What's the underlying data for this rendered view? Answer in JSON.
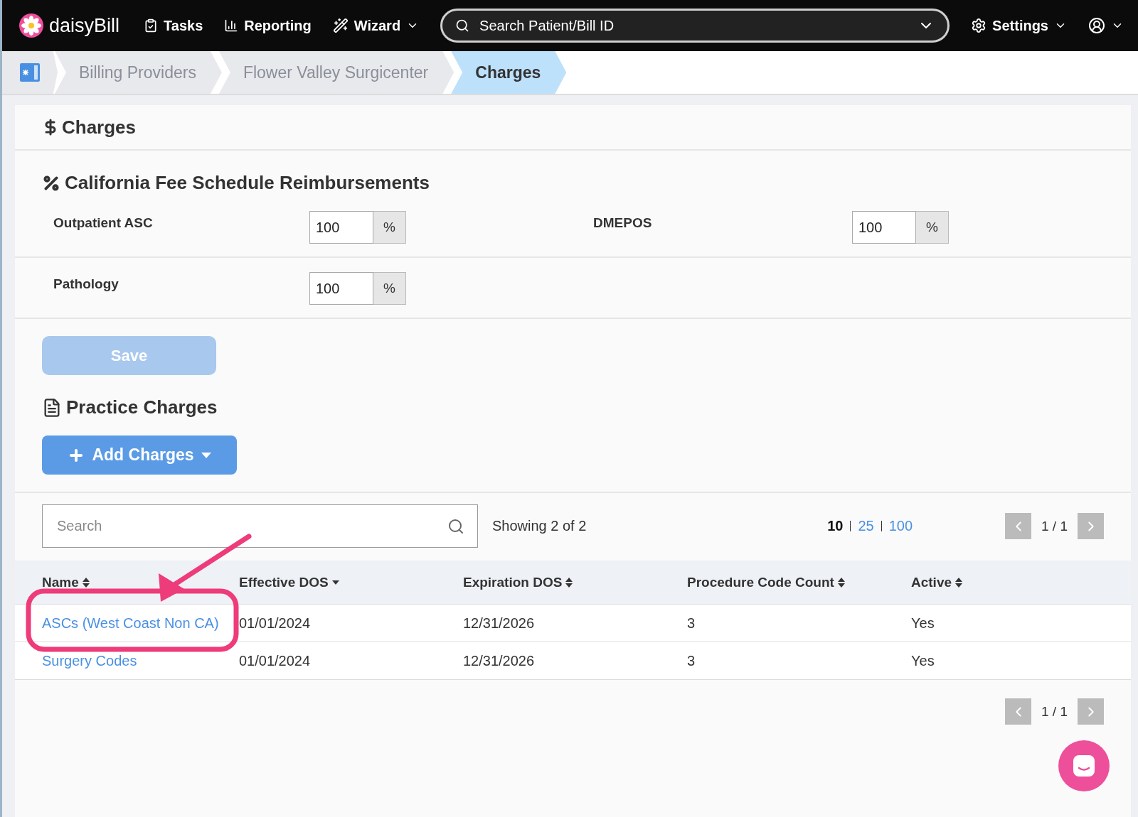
{
  "navbar": {
    "logo": "daisy**Bill**",
    "items": [
      {
        "kind": "tasks",
        "label": "Tasks",
        "dropdown": false
      },
      {
        "kind": "reporting",
        "label": "Reporting",
        "dropdown": false
      },
      {
        "kind": "wizard",
        "label": "Wizard",
        "dropdown": true
      }
    ],
    "search": {
      "placeholder": "Search Patient/Bill ID"
    },
    "settings": {
      "label": "Settings"
    }
  },
  "breadcrumb": [
    {
      "label": "Billing Providers",
      "selected": false
    },
    {
      "label": "Flower Valley Surgicenter",
      "selected": false
    },
    {
      "label": "Charges",
      "selected": true
    }
  ],
  "page_title": "Charges",
  "fee_schedule": {
    "title": "California Fee Schedule Reimbursements",
    "rows": [
      [
        {
          "label": "Outpatient ASC",
          "value": "100",
          "unit": "%"
        },
        {
          "label": "DMEPOS",
          "value": "100",
          "unit": "%"
        }
      ],
      [
        {
          "label": "Pathology",
          "value": "100",
          "unit": "%"
        }
      ]
    ],
    "save": {
      "label": "Save",
      "disabled": true
    }
  },
  "practice_charges": {
    "title": "Practice Charges",
    "add_button": "Add Charges",
    "search": {
      "placeholder": "Search"
    },
    "showing": "Showing 2 of 2",
    "page_sizes": [
      {
        "label": "10",
        "selected": true
      },
      {
        "label": "25",
        "selected": false
      },
      {
        "label": "100",
        "selected": false
      }
    ],
    "page": "1 / 1",
    "page_bottom": "1 / 1",
    "columns": [
      {
        "label": "Name",
        "sorted": false
      },
      {
        "label": "Effective DOS",
        "sorted": true
      },
      {
        "label": "Expiration DOS",
        "sorted": false
      },
      {
        "label": "Procedure Code Count",
        "sorted": false
      },
      {
        "label": "Active",
        "sorted": false
      }
    ],
    "rows": [
      [
        "ASCs (West Coast Non CA)",
        "01/01/2024",
        "12/31/2026",
        "3",
        "Yes"
      ],
      [
        "Surgery Codes",
        "01/01/2024",
        "12/31/2026",
        "3",
        "Yes"
      ]
    ]
  }
}
